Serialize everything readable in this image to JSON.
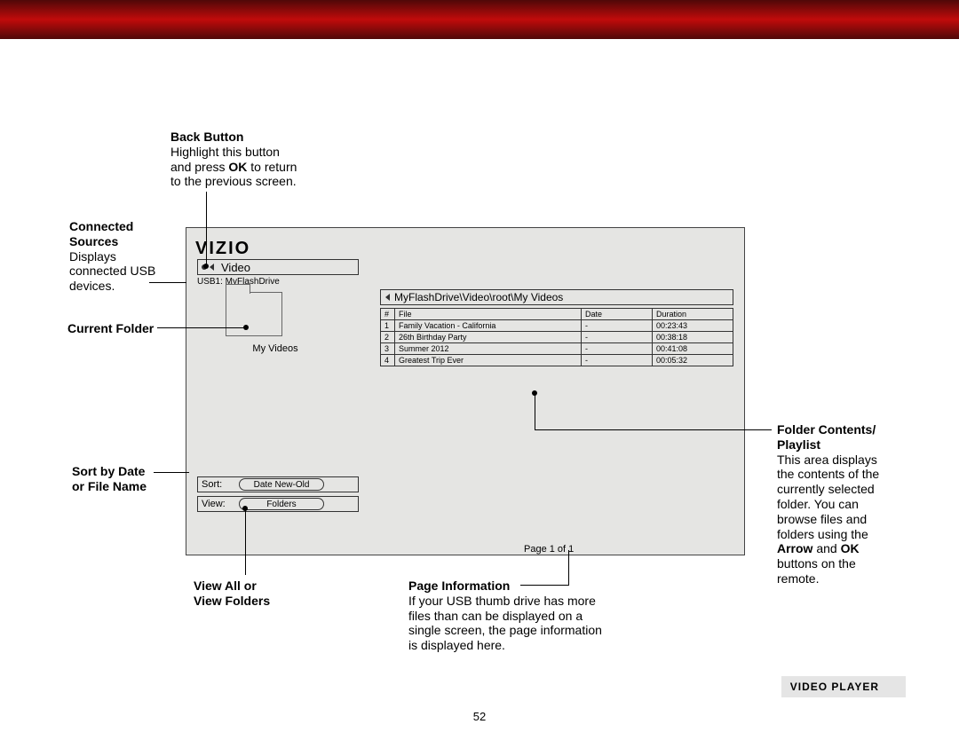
{
  "annotations": {
    "back": {
      "title": "Back Button",
      "body1": "Highlight this button",
      "body2": "and press ",
      "bold2": "OK",
      "body3": " to return",
      "body4": "to the previous screen."
    },
    "sources": {
      "title": "Connected",
      "title2": "Sources",
      "body1": "Displays",
      "body2": "connected USB",
      "body3": "devices."
    },
    "current": {
      "title": "Current Folder"
    },
    "sort": {
      "line1": "Sort by Date",
      "line2": "or File Name"
    },
    "viewall": {
      "line1": "View All or",
      "line2": "View Folders"
    },
    "pageinfo": {
      "title": "Page Information",
      "body1": "If your USB thumb drive has more",
      "body2": "files than can be displayed on a",
      "body3": "single screen, the page information",
      "body4": "is displayed here."
    },
    "contents": {
      "title1": "Folder Contents/",
      "title2": "Playlist",
      "body1": "This area displays",
      "body2": "the contents of the",
      "body3": "currently selected",
      "body4": "folder. You can",
      "body5": "browse files and",
      "body6": "folders using the",
      "bold6": "Arrow",
      "mid6": " and ",
      "bold6b": "OK",
      "body7": "buttons on the",
      "body8": "remote."
    }
  },
  "tv": {
    "brand": "VIZIO",
    "modeLabel": "Video",
    "usb": "USB1: MyFlashDrive",
    "folderName": "My Videos",
    "sortLabel": "Sort:",
    "sortValue": "Date New-Old",
    "viewLabel": "View:",
    "viewValue": "Folders",
    "breadcrumb": "MyFlashDrive\\Video\\root\\My Videos",
    "headers": {
      "num": "#",
      "file": "File",
      "date": "Date",
      "duration": "Duration"
    },
    "rows": [
      {
        "num": "1",
        "file": "Family Vacation - California",
        "date": "-",
        "duration": "00:23:43"
      },
      {
        "num": "2",
        "file": "26th Birthday Party",
        "date": "-",
        "duration": "00:38:18"
      },
      {
        "num": "3",
        "file": "Summer 2012",
        "date": "-",
        "duration": "00:41:08"
      },
      {
        "num": "4",
        "file": "Greatest Trip Ever",
        "date": "-",
        "duration": "00:05:32"
      }
    ],
    "pageInfo": "Page 1 of 1"
  },
  "caption": "VIDEO PLAYER",
  "pageNumber": "52"
}
